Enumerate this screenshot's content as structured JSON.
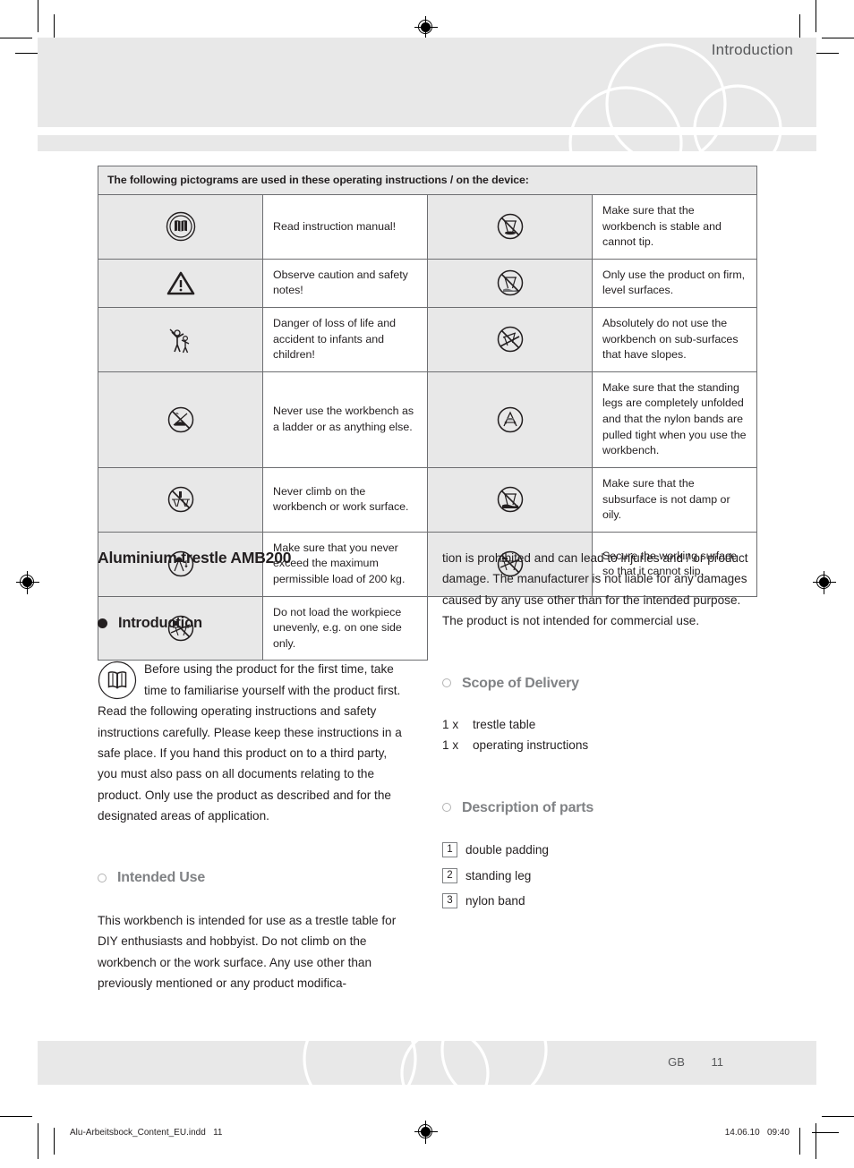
{
  "header": {
    "title": "Introduction"
  },
  "picto_table": {
    "caption": "The following pictograms are used in these operating instructions / on the device:",
    "rows": [
      {
        "left_icon": "read-manual-icon",
        "left_text": "Read instruction manual!",
        "right_icon": "no-unstable-workbench-icon",
        "right_text": "Make sure that the workbench is stable and cannot tip."
      },
      {
        "left_icon": "warning-triangle-icon",
        "left_text": "Observe caution and safety notes!",
        "right_icon": "firm-level-surface-icon",
        "right_text": "Only use the product on firm, level surfaces."
      },
      {
        "left_icon": "children-danger-icon",
        "left_text": "Danger of loss of life and accident to infants and children!",
        "right_icon": "no-sloped-surface-icon",
        "right_text": "Absolutely do not use the workbench on sub-surfaces that have slopes."
      },
      {
        "left_icon": "no-ladder-icon",
        "left_text": "Never use the workbench as a ladder or as anything else.",
        "right_icon": "unfold-legs-icon",
        "right_text": "Make sure that the standing legs are completely unfolded and that the nylon bands are pulled tight when you use the workbench."
      },
      {
        "left_icon": "no-climbing-icon",
        "left_text": "Never climb on the workbench or work surface.",
        "right_icon": "no-damp-oily-subsurface-icon",
        "right_text": "Make sure that the subsurface is not damp or oily."
      },
      {
        "left_icon": "max-load-icon",
        "left_text": "Make sure that you never exceed the maximum permissible load of 200 kg.",
        "right_icon": "secure-working-surface-icon",
        "right_text": "Secure the working surface so that it cannot slip."
      },
      {
        "left_icon": "no-uneven-load-icon",
        "left_text": "Do not load the workpiece unevenly, e.g. on one side only.",
        "right_icon": "",
        "right_text": ""
      }
    ]
  },
  "left_column": {
    "product_title": "Aluminium trestle AMB200",
    "introduction_heading": "Introduction",
    "introduction_icon": "read-manual-icon",
    "introduction_text": "Before using the product for the first time, take time to familiarise yourself with the product first. Read the following operating instructions and safety instructions carefully. Please keep these instructions in a safe place. If you hand this product on to a third party, you must also pass on all documents relating to the product. Only use the product as described and for the designated areas of application.",
    "intended_use_heading": "Intended Use",
    "intended_use_text": "This workbench is intended for use as a trestle table for DIY enthusiasts and hobbyist. Do not climb on the workbench or the work surface. Any use other than previously mentioned or any product modifica-"
  },
  "right_column": {
    "continued_text": "tion is prohibited and can lead to injuries and / or product damage. The manufacturer is not liable for any damages caused by any use other than for the intended purpose. The product is not intended for commercial use.",
    "scope_heading": "Scope of Delivery",
    "scope_items": [
      {
        "qty": "1 x",
        "label": "trestle table"
      },
      {
        "qty": "1 x",
        "label": "operating instructions"
      }
    ],
    "parts_heading": "Description of parts",
    "parts_items": [
      {
        "num": "1",
        "label": "double padding"
      },
      {
        "num": "2",
        "label": "standing leg"
      },
      {
        "num": "3",
        "label": "nylon band"
      }
    ]
  },
  "footer": {
    "language_code": "GB",
    "page_number": "11"
  },
  "print_footer": {
    "filename": "Alu-Arbeitsbock_Content_EU.indd   11",
    "timestamp": "14.06.10   09:40"
  },
  "colors": {
    "band_gray": "#e8e8e8",
    "heading_gray": "#808285",
    "text_black": "#231f20",
    "rule_gray": "#6d6e71"
  }
}
